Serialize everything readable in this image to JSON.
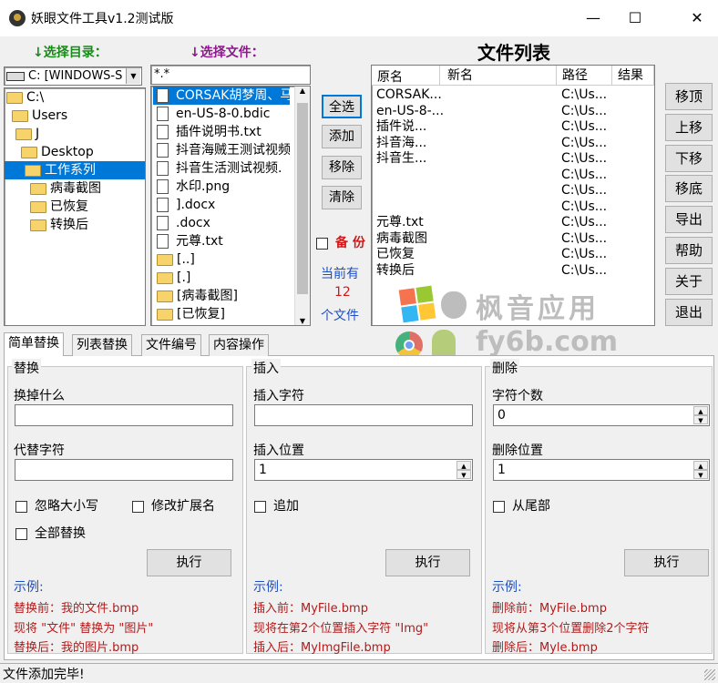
{
  "window": {
    "title": "妖眼文件工具v1.2测试版",
    "minimize": "—",
    "maximize": "☐",
    "close": "✕"
  },
  "left": {
    "dir_label": "↓选择目录：",
    "drive": "C: [WINDOWS-S",
    "tree": [
      "C:\\",
      "Users",
      "J",
      "Desktop",
      "工作系列",
      "病毒截图",
      "已恢复",
      "转换后"
    ]
  },
  "middle": {
    "file_label": "↓选择文件：",
    "filter": "*.*",
    "files": [
      "CORSAK胡梦周、马",
      "en-US-8-0.bdic",
      "插件说明书.txt",
      "抖音海贼王测试视频",
      "抖音生活测试视频.",
      "水印.png",
      "].docx",
      ".docx",
      "元尊.txt",
      "[..]",
      "[.]",
      "[病毒截图]",
      "[已恢复]"
    ]
  },
  "actions": {
    "select_all": "全选",
    "add": "添加",
    "remove": "移除",
    "clear": "清除",
    "backup": "备 份",
    "count_prefix": "当前有",
    "count": "12",
    "count_suffix": "个文件"
  },
  "list": {
    "title": "文件列表",
    "headers": [
      "原名",
      "新名",
      "路径",
      "结果"
    ],
    "rows": [
      {
        "name": "CORSAK...",
        "path": "C:\\Us..."
      },
      {
        "name": "en-US-8-...",
        "path": "C:\\Us..."
      },
      {
        "name": "插件说...",
        "path": "C:\\Us..."
      },
      {
        "name": "抖音海...",
        "path": "C:\\Us..."
      },
      {
        "name": "抖音生...",
        "path": "C:\\Us..."
      },
      {
        "name": "",
        "path": "C:\\Us..."
      },
      {
        "name": "",
        "path": "C:\\Us..."
      },
      {
        "name": "",
        "path": "C:\\Us..."
      },
      {
        "name": "元尊.txt",
        "path": "C:\\Us..."
      },
      {
        "name": "病毒截图",
        "path": "C:\\Us..."
      },
      {
        "name": "已恢复",
        "path": "C:\\Us..."
      },
      {
        "name": "转换后",
        "path": "C:\\Us..."
      }
    ]
  },
  "right_buttons": [
    "移顶",
    "上移",
    "下移",
    "移底",
    "导出",
    "帮助",
    "关于",
    "退出"
  ],
  "watermark": {
    "line1": "枫音应用",
    "line2": "fy6b.com"
  },
  "tabs": [
    "简单替换",
    "列表替换",
    "文件编号",
    "内容操作"
  ],
  "replace": {
    "title": "替换",
    "find_label": "换掉什么",
    "replace_label": "代替字符",
    "ignore_case": "忽略大小写",
    "modify_ext": "修改扩展名",
    "replace_all": "全部替换",
    "execute": "执行",
    "example_label": "示例:",
    "ex1": "替换前：我的文件.bmp",
    "ex2": "现将 \"文件\" 替换为 \"图片\"",
    "ex3": "替换后：我的图片.bmp"
  },
  "insert": {
    "title": "插入",
    "insert_label": "插入字符",
    "position_label": "插入位置",
    "position": "1",
    "append": "追加",
    "execute": "执行",
    "example_label": "示例:",
    "ex1": "插入前：MyFile.bmp",
    "ex2": "现将在第2个位置插入字符 \"Img\"",
    "ex3": "插入后：MyImgFile.bmp"
  },
  "delete": {
    "title": "删除",
    "count_label": "字符个数",
    "count": "0",
    "position_label": "删除位置",
    "position": "1",
    "from_end": "从尾部",
    "execute": "执行",
    "example_label": "示例:",
    "ex1": "删除前：MyFile.bmp",
    "ex2": "现将从第3个位置删除2个字符",
    "ex3": "删除后：Myle.bmp"
  },
  "status": "文件添加完毕!"
}
